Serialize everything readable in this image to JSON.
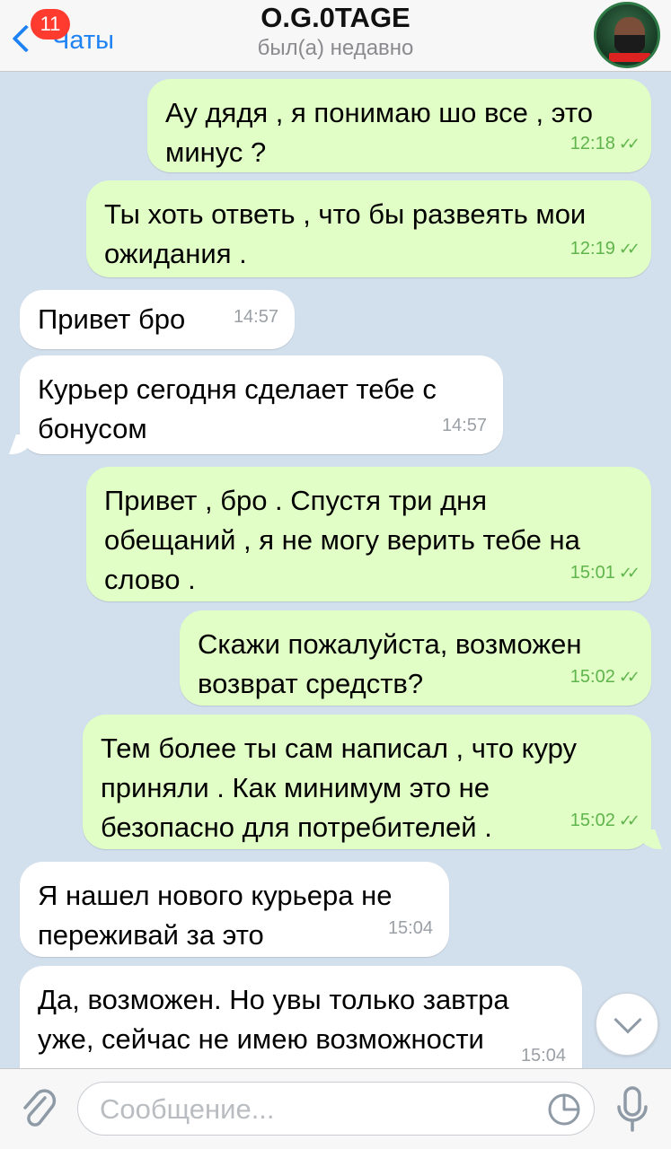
{
  "header": {
    "back_label": "Чаты",
    "unread_count": "11",
    "title": "O.G.0TAGE",
    "status": "был(а) недавно"
  },
  "messages": [
    {
      "direction": "out",
      "text": "Ау дядя , я понимаю шо все , это\nминус ?",
      "time": "12:18"
    },
    {
      "direction": "out",
      "text": "Ты хоть ответь , что бы развеять мои\nожидания .",
      "time": "12:19"
    },
    {
      "direction": "in",
      "text": "Привет бро",
      "time": "14:57"
    },
    {
      "direction": "in",
      "text": "Курьер сегодня сделает тебе с\nбонусом",
      "time": "14:57"
    },
    {
      "direction": "out",
      "text": "Привет , бро . Спустя три дня\nобещаний , я не могу верить тебе на\nслово .",
      "time": "15:01"
    },
    {
      "direction": "out",
      "text": "Скажи пожалуйста, возможен\nвозврат средств?",
      "time": "15:02"
    },
    {
      "direction": "out",
      "text": "Тем более ты сам написал , что куру\nприняли . Как минимум это не\nбезопасно для потребителей .",
      "time": "15:02"
    },
    {
      "direction": "in",
      "text": "Я нашел нового курьера не\nпереживай за это",
      "time": "15:04"
    },
    {
      "direction": "in",
      "text": "Да, возможен. Но увы только завтра\nуже, сейчас не имею возможности",
      "time": "15:04"
    }
  ],
  "input": {
    "placeholder": "Сообщение..."
  },
  "icons": {
    "back": "chevron-left-icon",
    "attach": "paperclip-icon",
    "sticker": "sticker-icon",
    "mic": "microphone-icon",
    "scroll": "chevron-down-icon"
  },
  "colors": {
    "accent": "#1f82f3",
    "outgoing_bubble": "#e1fec6",
    "incoming_bubble": "#ffffff",
    "badge": "#ff3b30",
    "background": "#d2dfec"
  }
}
